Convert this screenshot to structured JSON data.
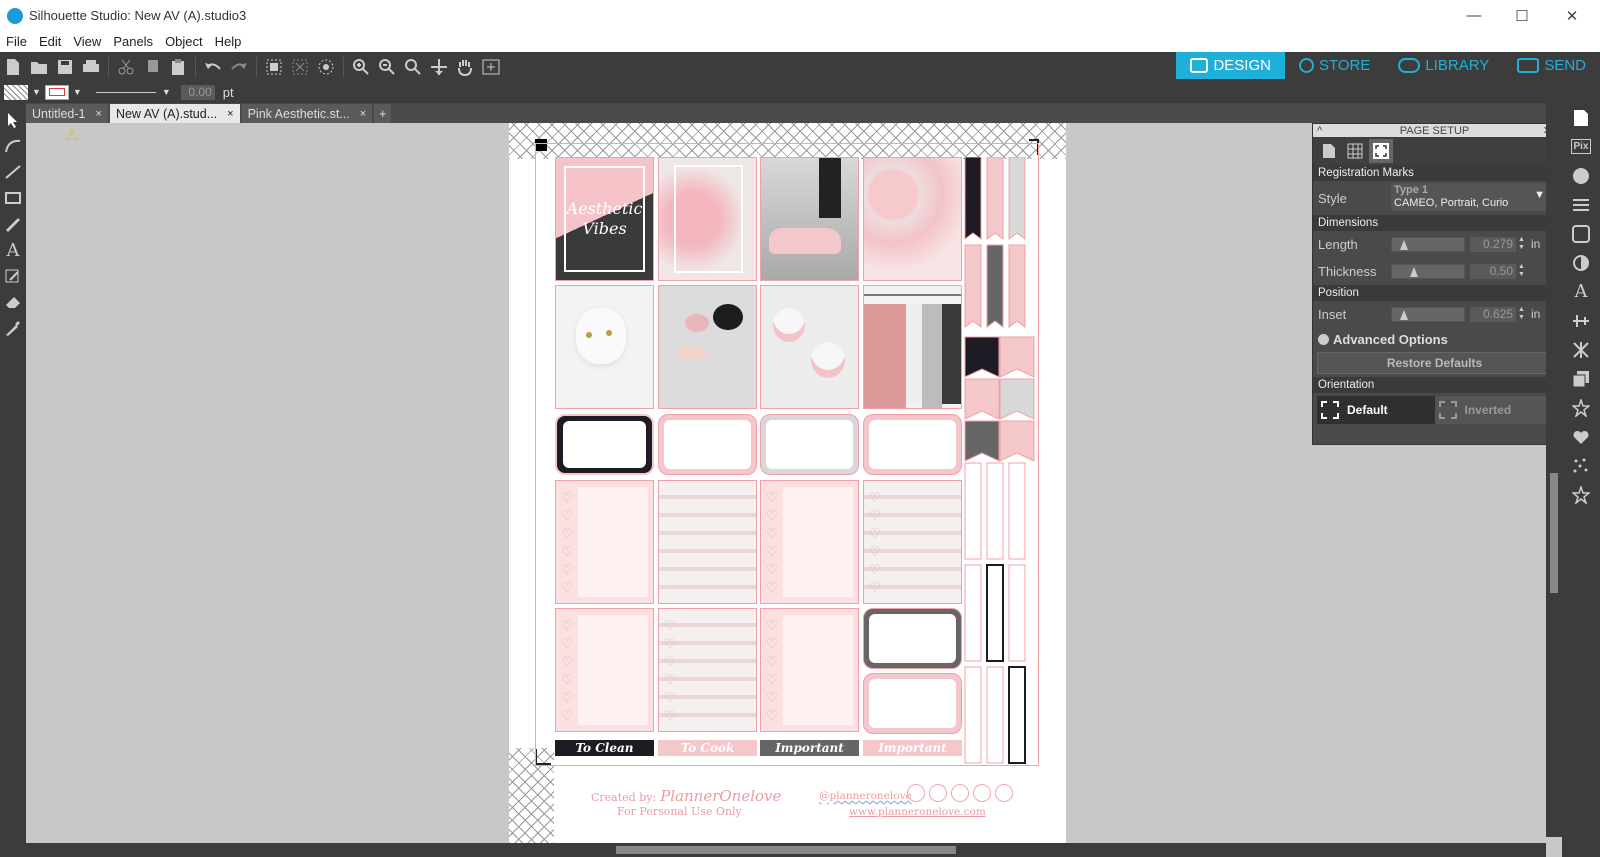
{
  "window": {
    "title": "Silhouette Studio: New AV (A).studio3",
    "minimize": "—",
    "maximize": "☐",
    "close": "✕"
  },
  "menu": [
    "File",
    "Edit",
    "View",
    "Panels",
    "Object",
    "Help"
  ],
  "mode_tabs": [
    {
      "label": "DESIGN",
      "icon": "grid-icon",
      "active": true
    },
    {
      "label": "STORE",
      "icon": "silhouette-s-icon"
    },
    {
      "label": "LIBRARY",
      "icon": "cloud-icon"
    },
    {
      "label": "SEND",
      "icon": "cutter-icon"
    }
  ],
  "options_bar": {
    "line_width": "0.00",
    "unit": "pt"
  },
  "doc_tabs": [
    {
      "label": "Untitled-1",
      "close": "×"
    },
    {
      "label": "New AV (A).stud...",
      "close": "×",
      "active": true
    },
    {
      "label": "Pink Aesthetic.st...",
      "close": "×"
    }
  ],
  "new_tab": "+",
  "warning_icon": "⚠",
  "page": {
    "tile_text": "Aesthetic Vibes",
    "labels": [
      "To Clean",
      "To Cook",
      "Important",
      "Important"
    ],
    "footer": {
      "created_by": "Created by:",
      "brand": "PlannerOnelove",
      "personal_use": "For Personal Use Only",
      "handle": "@planneronelove",
      "website": "www.planneronelove.com"
    },
    "colors": {
      "pink": "#f4c7cb",
      "light_pink": "#fbe3e5",
      "black": "#1e1b25",
      "gray": "#666666",
      "cut_line": "#f3a3a8"
    }
  },
  "page_setup": {
    "header": "PAGE SETUP",
    "collapse": "^",
    "close": "✕",
    "registration_marks": "Registration Marks",
    "style_label": "Style",
    "style_value": "Type 1",
    "style_sub": "CAMEO, Portrait, Curio",
    "dimensions": "Dimensions",
    "length_label": "Length",
    "length_value": "0.279",
    "length_unit": "in",
    "thickness_label": "Thickness",
    "thickness_value": "0.50",
    "position": "Position",
    "inset_label": "Inset",
    "inset_value": "0.625",
    "inset_unit": "in",
    "advanced": "Advanced Options",
    "restore": "Restore Defaults",
    "orientation": "Orientation",
    "default": "Default",
    "inverted": "Inverted"
  }
}
